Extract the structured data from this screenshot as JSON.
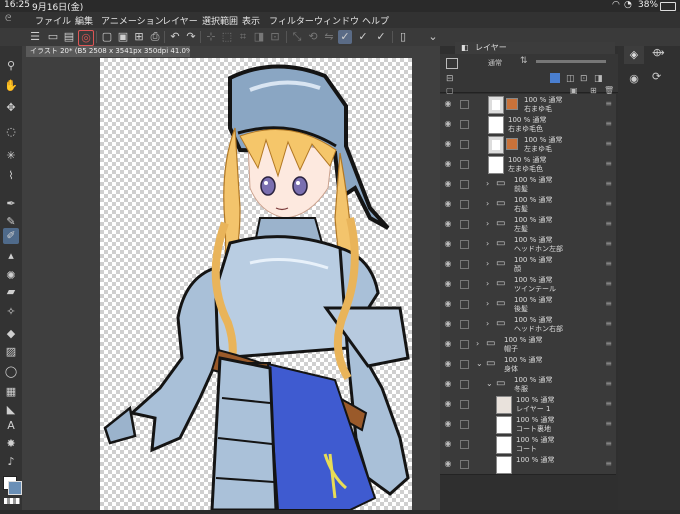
{
  "status": {
    "time": "16:25",
    "date": "9月16日(金)",
    "battery": "38%"
  },
  "menu": [
    "ファイル",
    "編集",
    "アニメーション",
    "レイヤー",
    "選択範囲",
    "表示",
    "フィルター",
    "ウィンドウ",
    "ヘルプ"
  ],
  "document": {
    "tab": "イラスト 20* (B5 2508 x 3541px 350dpi 41.0%)"
  },
  "layers_panel": {
    "title": "レイヤー",
    "blend": "通常",
    "layers": [
      {
        "pct": "100 % 通常",
        "name": "右まゆ毛",
        "type": "thumb-ghost"
      },
      {
        "pct": "100 % 通常",
        "name": "右まゆ毛色",
        "type": "thumb"
      },
      {
        "pct": "100 % 通常",
        "name": "左まゆ毛",
        "type": "thumb-pic"
      },
      {
        "pct": "100 % 通常",
        "name": "左まゆ毛色",
        "type": "thumb"
      },
      {
        "pct": "100 % 通常",
        "name": "前髪",
        "type": "folder"
      },
      {
        "pct": "100 % 通常",
        "name": "右髪",
        "type": "folder"
      },
      {
        "pct": "100 % 通常",
        "name": "左髪",
        "type": "folder"
      },
      {
        "pct": "100 % 通常",
        "name": "ヘッドホン左部",
        "type": "folder"
      },
      {
        "pct": "100 % 通常",
        "name": "顔",
        "type": "folder"
      },
      {
        "pct": "100 % 通常",
        "name": "ツインテール",
        "type": "folder"
      },
      {
        "pct": "100 % 通常",
        "name": "後髪",
        "type": "folder"
      },
      {
        "pct": "100 % 通常",
        "name": "ヘッドホン右部",
        "type": "folder"
      },
      {
        "pct": "100 % 通常",
        "name": "帽子",
        "type": "folder-top"
      },
      {
        "pct": "100 % 通常",
        "name": "身体",
        "type": "folder-open"
      },
      {
        "pct": "100 % 通常",
        "name": "冬服",
        "type": "folder-open2"
      },
      {
        "pct": "100 % 通常",
        "name": "レイヤー 1",
        "type": "thumb-pic2"
      },
      {
        "pct": "100 % 通常",
        "name": "コート裏地",
        "type": "thumb2"
      },
      {
        "pct": "100 % 通常",
        "name": "コート",
        "type": "thumb2"
      },
      {
        "pct": "100 % 通常",
        "name": "",
        "type": "thumb2"
      }
    ]
  },
  "colors": {
    "main": "#6a8fb6",
    "sub": "#ffffff",
    "accent": "#3b6fb0"
  }
}
